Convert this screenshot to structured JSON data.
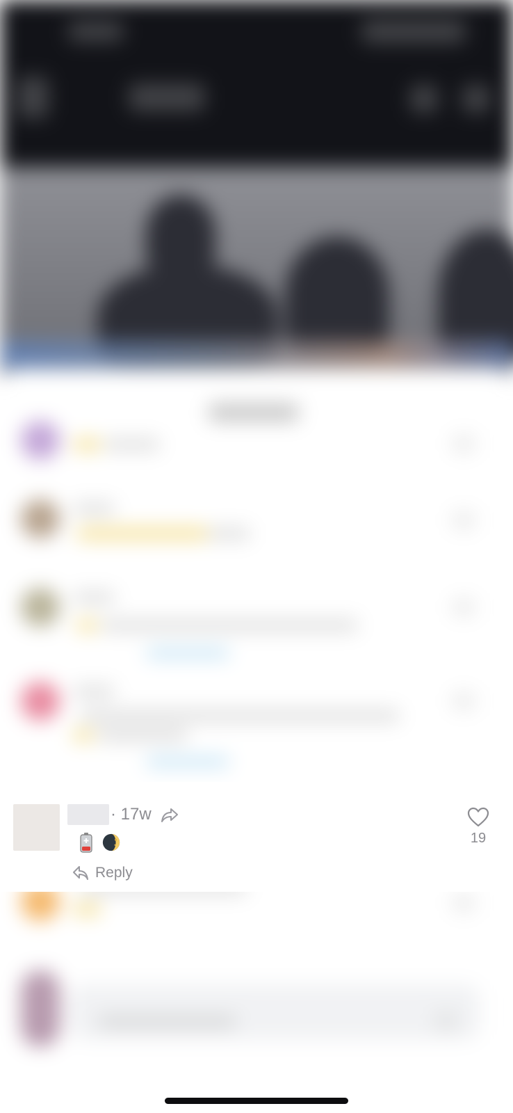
{
  "theme": {
    "muted_text": "#8c8c91",
    "background_dark": "#121318",
    "sheet_background": "#ffffff"
  },
  "focused_comment": {
    "timestamp": "· 17w",
    "reply_label": "Reply",
    "like_count": "19",
    "badges": [
      "battery-low-icon",
      "moon-icon"
    ]
  },
  "icons": {
    "share": "share-arrow-icon",
    "reply": "reply-arrow-icon",
    "like": "heart-outline-icon"
  }
}
